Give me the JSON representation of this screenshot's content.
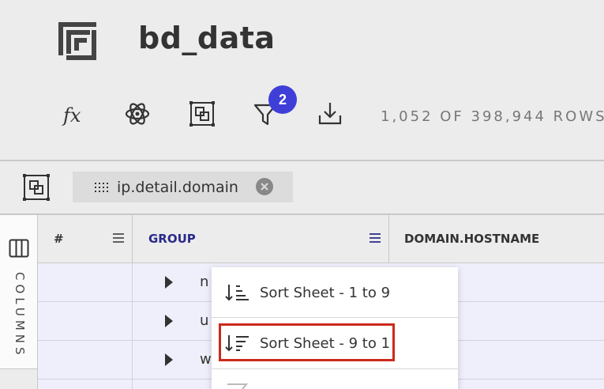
{
  "app": {
    "title": "bd_data",
    "logo_icon": "data-logo-icon"
  },
  "toolbar": {
    "buttons": [
      {
        "name": "formula-icon",
        "label": "fx"
      },
      {
        "name": "atom-icon"
      },
      {
        "name": "group-icon"
      },
      {
        "name": "filter-icon"
      },
      {
        "name": "download-icon"
      }
    ],
    "filter_badge": "2",
    "rows_count": "1,052 OF 398,944 ROWS"
  },
  "group_bar": {
    "chip_label": "ip.detail.domain"
  },
  "side_panel": {
    "label": "COLUMNS"
  },
  "grid": {
    "columns": [
      {
        "label": "#",
        "color": "#333333"
      },
      {
        "label": "GROUP",
        "color": "#2a2a8a"
      },
      {
        "label": "DOMAIN.HOSTNAME",
        "color": "#333333"
      }
    ],
    "rows": [
      {
        "text": "n"
      },
      {
        "text": "u"
      },
      {
        "text": "w"
      }
    ]
  },
  "context_menu": {
    "items": [
      {
        "label": "Sort Sheet - 1 to 9",
        "icon": "sort-ascending-icon"
      },
      {
        "label": "Sort Sheet - 9 to 1",
        "icon": "sort-descending-icon"
      }
    ]
  },
  "colors": {
    "accent": "#3f3fd8",
    "highlight": "#cc2a1c",
    "row_bg": "#efeffb"
  }
}
